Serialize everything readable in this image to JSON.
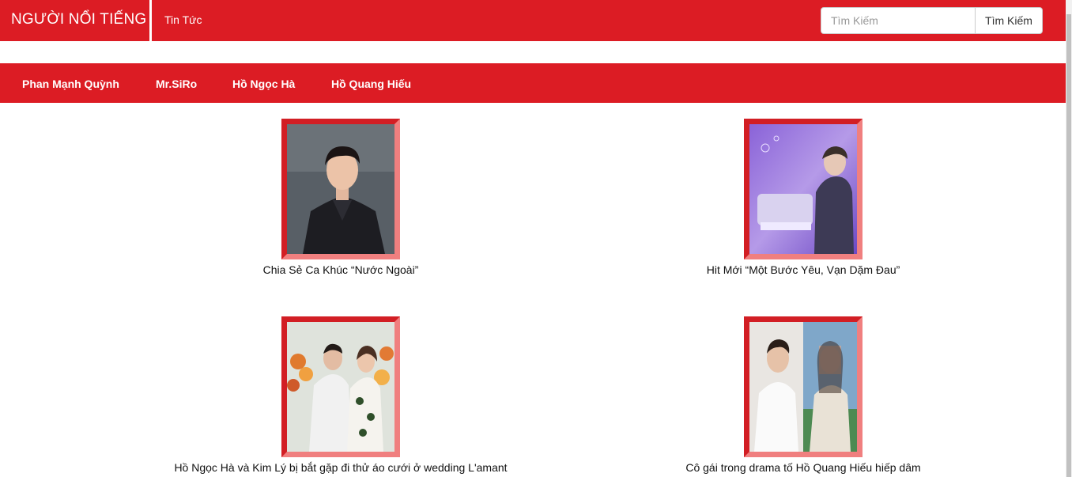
{
  "navbar": {
    "brand": "NGƯỜI NỔI TIẾNG",
    "news_link": "Tin Tức",
    "search": {
      "placeholder": "Tìm Kiếm",
      "button_label": "Tìm Kiếm"
    }
  },
  "categories": [
    {
      "label": "Phan Mạnh Quỳnh"
    },
    {
      "label": "Mr.SiRo"
    },
    {
      "label": "Hồ Ngọc Hà"
    },
    {
      "label": "Hồ Quang Hiếu"
    }
  ],
  "articles": [
    {
      "caption": "Chia Sẻ Ca Khúc “Nước Ngoài”"
    },
    {
      "caption": "Hit Mới “Một Bước Yêu, Vạn Dặm Đau”"
    },
    {
      "caption": "Hồ Ngọc Hà và Kim Lý bị bắt gặp đi thử áo cưới ở wedding L'amant"
    },
    {
      "caption": "Cô gái trong drama tố Hồ Quang Hiếu hiếp dâm"
    }
  ],
  "colors": {
    "brand_red": "#dc1c24",
    "frame_dark": "#d21e24",
    "frame_light": "#f07f7f"
  }
}
